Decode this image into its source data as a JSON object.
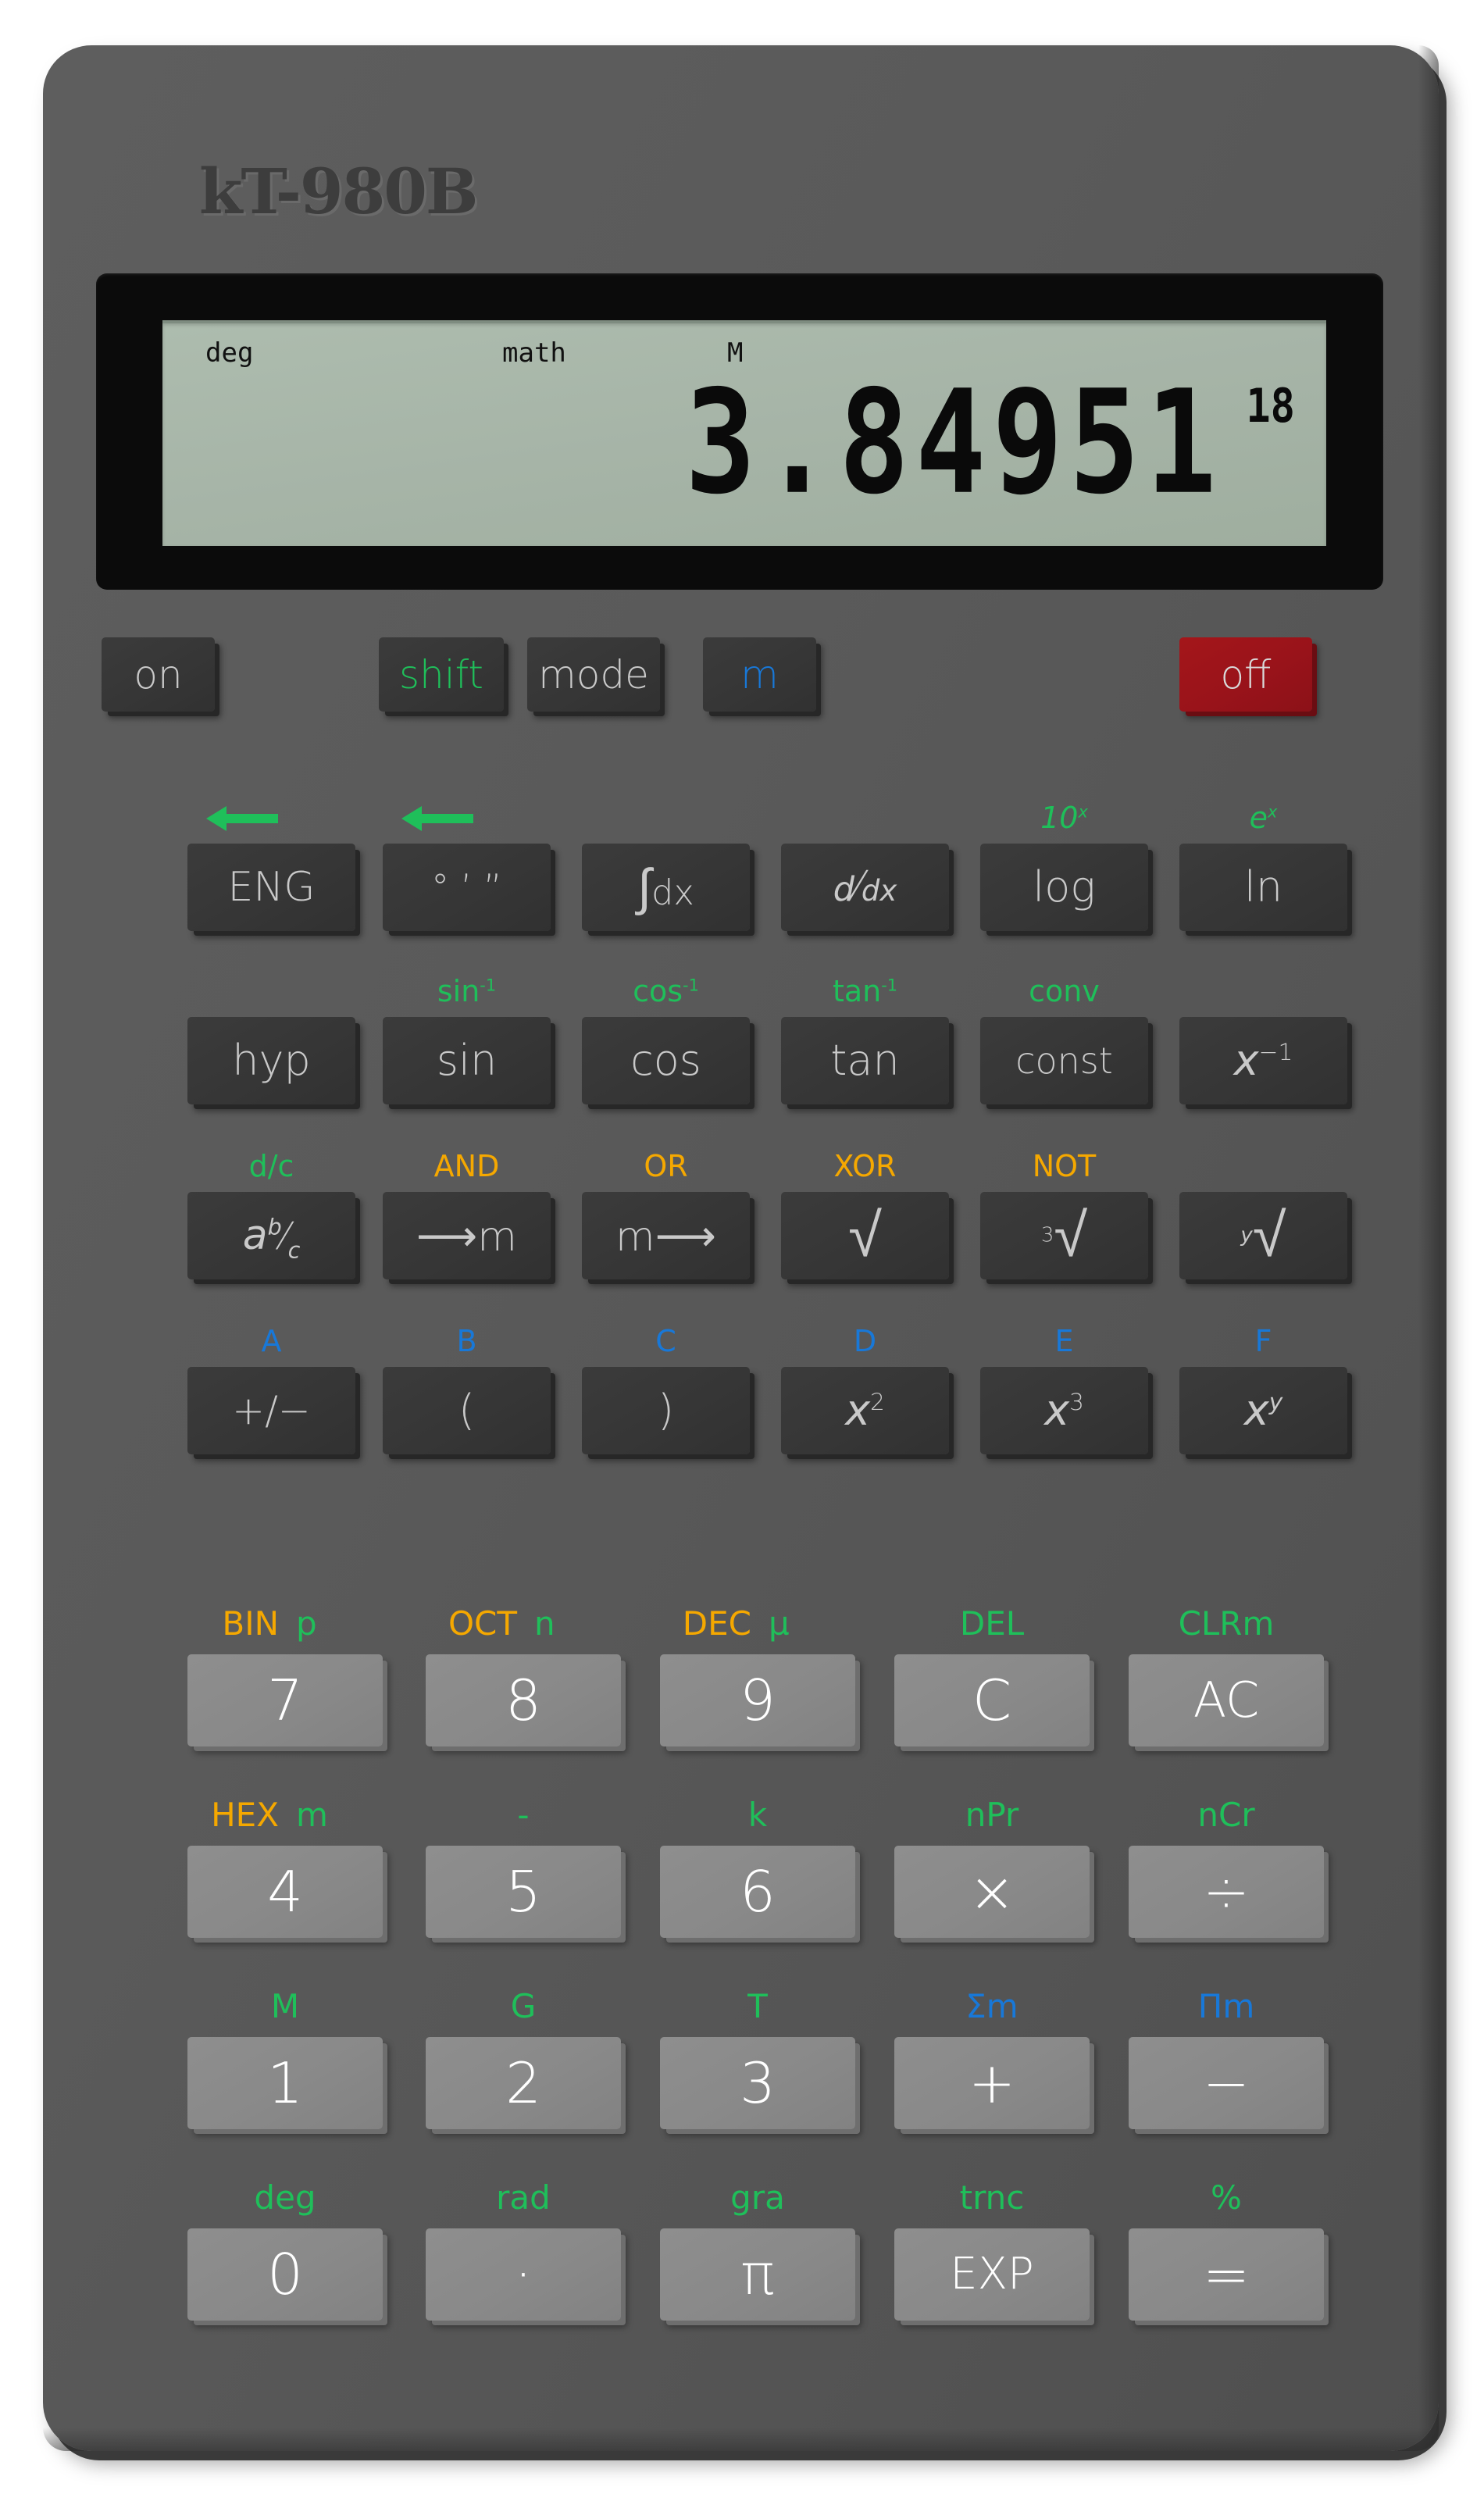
{
  "brand": "kT-980B",
  "colors": {
    "body": "#595959",
    "key_dark": "#363636",
    "key_light": "#898989",
    "key_off": "#99131a",
    "shift_green": "#1fbf5a",
    "alpha_orange": "#f5a800",
    "mem_blue": "#1878d8",
    "lcd": "#a6b4a7"
  },
  "display": {
    "indicators": {
      "angle": "deg",
      "math": "math",
      "memory": "M"
    },
    "value": "3.84951",
    "exponent": "18"
  },
  "power_row": [
    {
      "label": "on",
      "style": "dark",
      "text_color": "#c9c9c9"
    },
    {
      "label": "shift",
      "style": "dark",
      "text_color": "#1fbf5a"
    },
    {
      "label": "mode",
      "style": "dark",
      "text_color": "#c9c9c9"
    },
    {
      "label": "m",
      "style": "dark",
      "text_color": "#1878d8"
    },
    {
      "label": "off",
      "style": "red",
      "text_color": "#d9d9d9"
    }
  ],
  "function_rows": [
    {
      "row": 1,
      "keys": [
        {
          "label": "ENG",
          "secondary": "arrow-left",
          "sec_color": "green"
        },
        {
          "label": "° ’ ”",
          "secondary": "arrow-left",
          "sec_color": "green"
        },
        {
          "label": "∫dx",
          "secondary": "",
          "sec_color": ""
        },
        {
          "label": "d/dx",
          "secondary": "",
          "sec_color": ""
        },
        {
          "label": "log",
          "secondary": "10ˣ",
          "sec_color": "green"
        },
        {
          "label": "ln",
          "secondary": "eˣ",
          "sec_color": "green"
        }
      ]
    },
    {
      "row": 2,
      "keys": [
        {
          "label": "hyp",
          "secondary": "",
          "sec_color": ""
        },
        {
          "label": "sin",
          "secondary": "sin⁻¹",
          "sec_color": "green"
        },
        {
          "label": "cos",
          "secondary": "cos⁻¹",
          "sec_color": "green"
        },
        {
          "label": "tan",
          "secondary": "tan⁻¹",
          "sec_color": "green"
        },
        {
          "label": "const",
          "secondary": "conv",
          "sec_color": "green"
        },
        {
          "label": "x⁻¹",
          "secondary": "",
          "sec_color": ""
        }
      ]
    },
    {
      "row": 3,
      "keys": [
        {
          "label": "ab/c",
          "secondary": "d/c",
          "sec_color": "green"
        },
        {
          "label": "→m",
          "secondary": "AND",
          "sec_color": "orange"
        },
        {
          "label": "m→",
          "secondary": "OR",
          "sec_color": "orange"
        },
        {
          "label": "√",
          "secondary": "XOR",
          "sec_color": "orange"
        },
        {
          "label": "³√",
          "secondary": "NOT",
          "sec_color": "orange"
        },
        {
          "label": "ʸ√",
          "secondary": "",
          "sec_color": ""
        }
      ]
    },
    {
      "row": 4,
      "keys": [
        {
          "label": "+/−",
          "secondary": "A",
          "sec_color": "blue"
        },
        {
          "label": "(",
          "secondary": "B",
          "sec_color": "blue"
        },
        {
          "label": ")",
          "secondary": "C",
          "sec_color": "blue"
        },
        {
          "label": "x²",
          "secondary": "D",
          "sec_color": "blue"
        },
        {
          "label": "x³",
          "secondary": "E",
          "sec_color": "blue"
        },
        {
          "label": "xʸ",
          "secondary": "F",
          "sec_color": "blue"
        }
      ]
    }
  ],
  "numeric_rows": [
    {
      "row": 1,
      "keys": [
        {
          "label": "7",
          "sec1": "BIN",
          "sec1_color": "orange",
          "sec2": "p",
          "sec2_color": "green"
        },
        {
          "label": "8",
          "sec1": "OCT",
          "sec1_color": "orange",
          "sec2": "n",
          "sec2_color": "green"
        },
        {
          "label": "9",
          "sec1": "DEC",
          "sec1_color": "orange",
          "sec2": "µ",
          "sec2_color": "green"
        },
        {
          "label": "C",
          "sec1": "",
          "sec1_color": "",
          "sec2": "DEL",
          "sec2_color": "green"
        },
        {
          "label": "AC",
          "sec1": "",
          "sec1_color": "",
          "sec2": "CLRm",
          "sec2_color": "green"
        }
      ]
    },
    {
      "row": 2,
      "keys": [
        {
          "label": "4",
          "sec1": "HEX",
          "sec1_color": "orange",
          "sec2": "m",
          "sec2_color": "green"
        },
        {
          "label": "5",
          "sec1": "",
          "sec1_color": "",
          "sec2": "-",
          "sec2_color": "green"
        },
        {
          "label": "6",
          "sec1": "",
          "sec1_color": "",
          "sec2": "k",
          "sec2_color": "green"
        },
        {
          "label": "×",
          "sec1": "",
          "sec1_color": "",
          "sec2": "nPr",
          "sec2_color": "green"
        },
        {
          "label": "÷",
          "sec1": "",
          "sec1_color": "",
          "sec2": "nCr",
          "sec2_color": "green"
        }
      ]
    },
    {
      "row": 3,
      "keys": [
        {
          "label": "1",
          "sec1": "",
          "sec1_color": "",
          "sec2": "M",
          "sec2_color": "green"
        },
        {
          "label": "2",
          "sec1": "",
          "sec1_color": "",
          "sec2": "G",
          "sec2_color": "green"
        },
        {
          "label": "3",
          "sec1": "",
          "sec1_color": "",
          "sec2": "T",
          "sec2_color": "green"
        },
        {
          "label": "+",
          "sec1": "",
          "sec1_color": "",
          "sec2": "Σm",
          "sec2_color": "blue"
        },
        {
          "label": "−",
          "sec1": "",
          "sec1_color": "",
          "sec2": "Πm",
          "sec2_color": "blue"
        }
      ]
    },
    {
      "row": 4,
      "keys": [
        {
          "label": "0",
          "sec1": "",
          "sec1_color": "",
          "sec2": "deg",
          "sec2_color": "green"
        },
        {
          "label": "·",
          "sec1": "",
          "sec1_color": "",
          "sec2": "rad",
          "sec2_color": "green"
        },
        {
          "label": "π",
          "sec1": "",
          "sec1_color": "",
          "sec2": "gra",
          "sec2_color": "green"
        },
        {
          "label": "EXP",
          "sec1": "",
          "sec1_color": "",
          "sec2": "trnc",
          "sec2_color": "green"
        },
        {
          "label": "=",
          "sec1": "",
          "sec1_color": "",
          "sec2": "%",
          "sec2_color": "green"
        }
      ]
    }
  ]
}
